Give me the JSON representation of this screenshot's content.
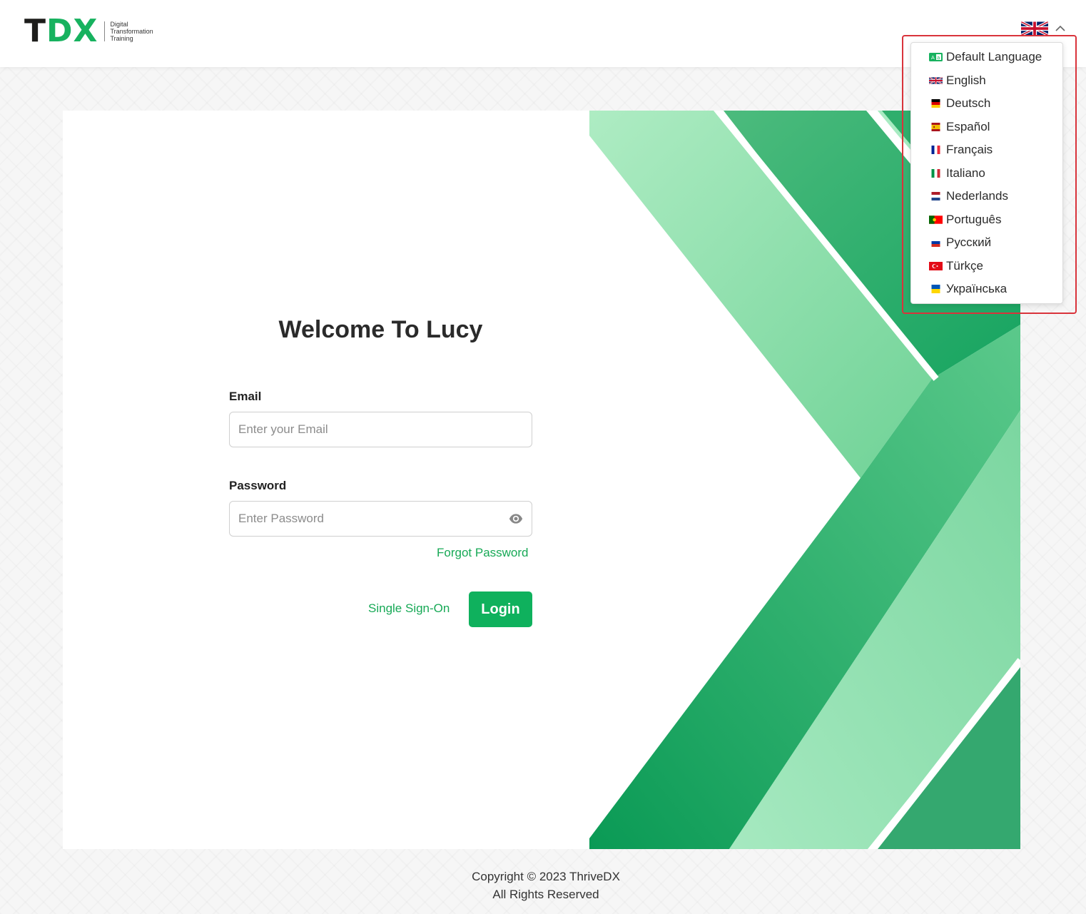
{
  "header": {
    "logo": {
      "mark_t": "T",
      "mark_dx": "DX",
      "line1": "Digital",
      "line2": "Transformation",
      "line3": "Training"
    },
    "language_toggle": {
      "current_flag": "flag-uk-icon",
      "chevron": "chevron-up-icon"
    }
  },
  "login": {
    "title": "Welcome To Lucy",
    "email_label": "Email",
    "email_placeholder": "Enter your Email",
    "email_value": "",
    "password_label": "Password",
    "password_placeholder": "Enter Password",
    "password_value": "",
    "forgot_password": "Forgot Password",
    "sso": "Single Sign-On",
    "login_button": "Login"
  },
  "language_menu": {
    "items": [
      {
        "label": "Default Language",
        "icon": "language-icon"
      },
      {
        "label": "English",
        "icon": "flag-uk-icon"
      },
      {
        "label": "Deutsch",
        "icon": "flag-de-icon"
      },
      {
        "label": "Español",
        "icon": "flag-es-icon"
      },
      {
        "label": "Français",
        "icon": "flag-fr-icon"
      },
      {
        "label": "Italiano",
        "icon": "flag-it-icon"
      },
      {
        "label": "Nederlands",
        "icon": "flag-nl-icon"
      },
      {
        "label": "Português",
        "icon": "flag-pt-icon"
      },
      {
        "label": "Русский",
        "icon": "flag-ru-icon"
      },
      {
        "label": "Türkçe",
        "icon": "flag-tr-icon"
      },
      {
        "label": "Українська",
        "icon": "flag-ua-icon"
      }
    ]
  },
  "footer": {
    "copyright": "Copyright © 2023 ThriveDX",
    "rights": "All Rights Reserved"
  },
  "colors": {
    "brand_green": "#0fb15d",
    "link_green": "#17a956",
    "highlight_red": "#d9333b"
  }
}
